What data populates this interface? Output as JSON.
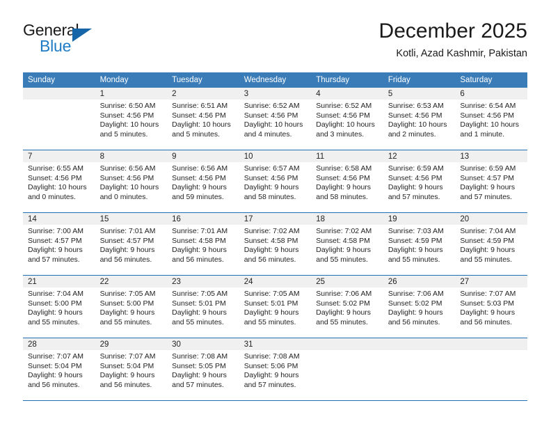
{
  "brand": {
    "name_top": "General",
    "name_bottom": "Blue",
    "accent_color": "#1f7cc4",
    "triangle_color": "#1565a8"
  },
  "header": {
    "title": "December 2025",
    "subtitle": "Kotli, Azad Kashmir, Pakistan"
  },
  "theme": {
    "header_bg": "#3a7cb8",
    "header_text": "#ffffff",
    "daynum_bg": "#f0f0f0",
    "row_divider": "#1f6db5",
    "body_text": "#222222"
  },
  "weekday_headers": [
    "Sunday",
    "Monday",
    "Tuesday",
    "Wednesday",
    "Thursday",
    "Friday",
    "Saturday"
  ],
  "weeks": [
    [
      {
        "day": "",
        "sunrise": "",
        "sunset": "",
        "daylight_line1": "",
        "daylight_line2": ""
      },
      {
        "day": "1",
        "sunrise": "Sunrise: 6:50 AM",
        "sunset": "Sunset: 4:56 PM",
        "daylight_line1": "Daylight: 10 hours",
        "daylight_line2": "and 5 minutes."
      },
      {
        "day": "2",
        "sunrise": "Sunrise: 6:51 AM",
        "sunset": "Sunset: 4:56 PM",
        "daylight_line1": "Daylight: 10 hours",
        "daylight_line2": "and 5 minutes."
      },
      {
        "day": "3",
        "sunrise": "Sunrise: 6:52 AM",
        "sunset": "Sunset: 4:56 PM",
        "daylight_line1": "Daylight: 10 hours",
        "daylight_line2": "and 4 minutes."
      },
      {
        "day": "4",
        "sunrise": "Sunrise: 6:52 AM",
        "sunset": "Sunset: 4:56 PM",
        "daylight_line1": "Daylight: 10 hours",
        "daylight_line2": "and 3 minutes."
      },
      {
        "day": "5",
        "sunrise": "Sunrise: 6:53 AM",
        "sunset": "Sunset: 4:56 PM",
        "daylight_line1": "Daylight: 10 hours",
        "daylight_line2": "and 2 minutes."
      },
      {
        "day": "6",
        "sunrise": "Sunrise: 6:54 AM",
        "sunset": "Sunset: 4:56 PM",
        "daylight_line1": "Daylight: 10 hours",
        "daylight_line2": "and 1 minute."
      }
    ],
    [
      {
        "day": "7",
        "sunrise": "Sunrise: 6:55 AM",
        "sunset": "Sunset: 4:56 PM",
        "daylight_line1": "Daylight: 10 hours",
        "daylight_line2": "and 0 minutes."
      },
      {
        "day": "8",
        "sunrise": "Sunrise: 6:56 AM",
        "sunset": "Sunset: 4:56 PM",
        "daylight_line1": "Daylight: 10 hours",
        "daylight_line2": "and 0 minutes."
      },
      {
        "day": "9",
        "sunrise": "Sunrise: 6:56 AM",
        "sunset": "Sunset: 4:56 PM",
        "daylight_line1": "Daylight: 9 hours",
        "daylight_line2": "and 59 minutes."
      },
      {
        "day": "10",
        "sunrise": "Sunrise: 6:57 AM",
        "sunset": "Sunset: 4:56 PM",
        "daylight_line1": "Daylight: 9 hours",
        "daylight_line2": "and 58 minutes."
      },
      {
        "day": "11",
        "sunrise": "Sunrise: 6:58 AM",
        "sunset": "Sunset: 4:56 PM",
        "daylight_line1": "Daylight: 9 hours",
        "daylight_line2": "and 58 minutes."
      },
      {
        "day": "12",
        "sunrise": "Sunrise: 6:59 AM",
        "sunset": "Sunset: 4:56 PM",
        "daylight_line1": "Daylight: 9 hours",
        "daylight_line2": "and 57 minutes."
      },
      {
        "day": "13",
        "sunrise": "Sunrise: 6:59 AM",
        "sunset": "Sunset: 4:57 PM",
        "daylight_line1": "Daylight: 9 hours",
        "daylight_line2": "and 57 minutes."
      }
    ],
    [
      {
        "day": "14",
        "sunrise": "Sunrise: 7:00 AM",
        "sunset": "Sunset: 4:57 PM",
        "daylight_line1": "Daylight: 9 hours",
        "daylight_line2": "and 57 minutes."
      },
      {
        "day": "15",
        "sunrise": "Sunrise: 7:01 AM",
        "sunset": "Sunset: 4:57 PM",
        "daylight_line1": "Daylight: 9 hours",
        "daylight_line2": "and 56 minutes."
      },
      {
        "day": "16",
        "sunrise": "Sunrise: 7:01 AM",
        "sunset": "Sunset: 4:58 PM",
        "daylight_line1": "Daylight: 9 hours",
        "daylight_line2": "and 56 minutes."
      },
      {
        "day": "17",
        "sunrise": "Sunrise: 7:02 AM",
        "sunset": "Sunset: 4:58 PM",
        "daylight_line1": "Daylight: 9 hours",
        "daylight_line2": "and 56 minutes."
      },
      {
        "day": "18",
        "sunrise": "Sunrise: 7:02 AM",
        "sunset": "Sunset: 4:58 PM",
        "daylight_line1": "Daylight: 9 hours",
        "daylight_line2": "and 55 minutes."
      },
      {
        "day": "19",
        "sunrise": "Sunrise: 7:03 AM",
        "sunset": "Sunset: 4:59 PM",
        "daylight_line1": "Daylight: 9 hours",
        "daylight_line2": "and 55 minutes."
      },
      {
        "day": "20",
        "sunrise": "Sunrise: 7:04 AM",
        "sunset": "Sunset: 4:59 PM",
        "daylight_line1": "Daylight: 9 hours",
        "daylight_line2": "and 55 minutes."
      }
    ],
    [
      {
        "day": "21",
        "sunrise": "Sunrise: 7:04 AM",
        "sunset": "Sunset: 5:00 PM",
        "daylight_line1": "Daylight: 9 hours",
        "daylight_line2": "and 55 minutes."
      },
      {
        "day": "22",
        "sunrise": "Sunrise: 7:05 AM",
        "sunset": "Sunset: 5:00 PM",
        "daylight_line1": "Daylight: 9 hours",
        "daylight_line2": "and 55 minutes."
      },
      {
        "day": "23",
        "sunrise": "Sunrise: 7:05 AM",
        "sunset": "Sunset: 5:01 PM",
        "daylight_line1": "Daylight: 9 hours",
        "daylight_line2": "and 55 minutes."
      },
      {
        "day": "24",
        "sunrise": "Sunrise: 7:05 AM",
        "sunset": "Sunset: 5:01 PM",
        "daylight_line1": "Daylight: 9 hours",
        "daylight_line2": "and 55 minutes."
      },
      {
        "day": "25",
        "sunrise": "Sunrise: 7:06 AM",
        "sunset": "Sunset: 5:02 PM",
        "daylight_line1": "Daylight: 9 hours",
        "daylight_line2": "and 55 minutes."
      },
      {
        "day": "26",
        "sunrise": "Sunrise: 7:06 AM",
        "sunset": "Sunset: 5:02 PM",
        "daylight_line1": "Daylight: 9 hours",
        "daylight_line2": "and 56 minutes."
      },
      {
        "day": "27",
        "sunrise": "Sunrise: 7:07 AM",
        "sunset": "Sunset: 5:03 PM",
        "daylight_line1": "Daylight: 9 hours",
        "daylight_line2": "and 56 minutes."
      }
    ],
    [
      {
        "day": "28",
        "sunrise": "Sunrise: 7:07 AM",
        "sunset": "Sunset: 5:04 PM",
        "daylight_line1": "Daylight: 9 hours",
        "daylight_line2": "and 56 minutes."
      },
      {
        "day": "29",
        "sunrise": "Sunrise: 7:07 AM",
        "sunset": "Sunset: 5:04 PM",
        "daylight_line1": "Daylight: 9 hours",
        "daylight_line2": "and 56 minutes."
      },
      {
        "day": "30",
        "sunrise": "Sunrise: 7:08 AM",
        "sunset": "Sunset: 5:05 PM",
        "daylight_line1": "Daylight: 9 hours",
        "daylight_line2": "and 57 minutes."
      },
      {
        "day": "31",
        "sunrise": "Sunrise: 7:08 AM",
        "sunset": "Sunset: 5:06 PM",
        "daylight_line1": "Daylight: 9 hours",
        "daylight_line2": "and 57 minutes."
      },
      {
        "day": "",
        "sunrise": "",
        "sunset": "",
        "daylight_line1": "",
        "daylight_line2": ""
      },
      {
        "day": "",
        "sunrise": "",
        "sunset": "",
        "daylight_line1": "",
        "daylight_line2": ""
      },
      {
        "day": "",
        "sunrise": "",
        "sunset": "",
        "daylight_line1": "",
        "daylight_line2": ""
      }
    ]
  ]
}
